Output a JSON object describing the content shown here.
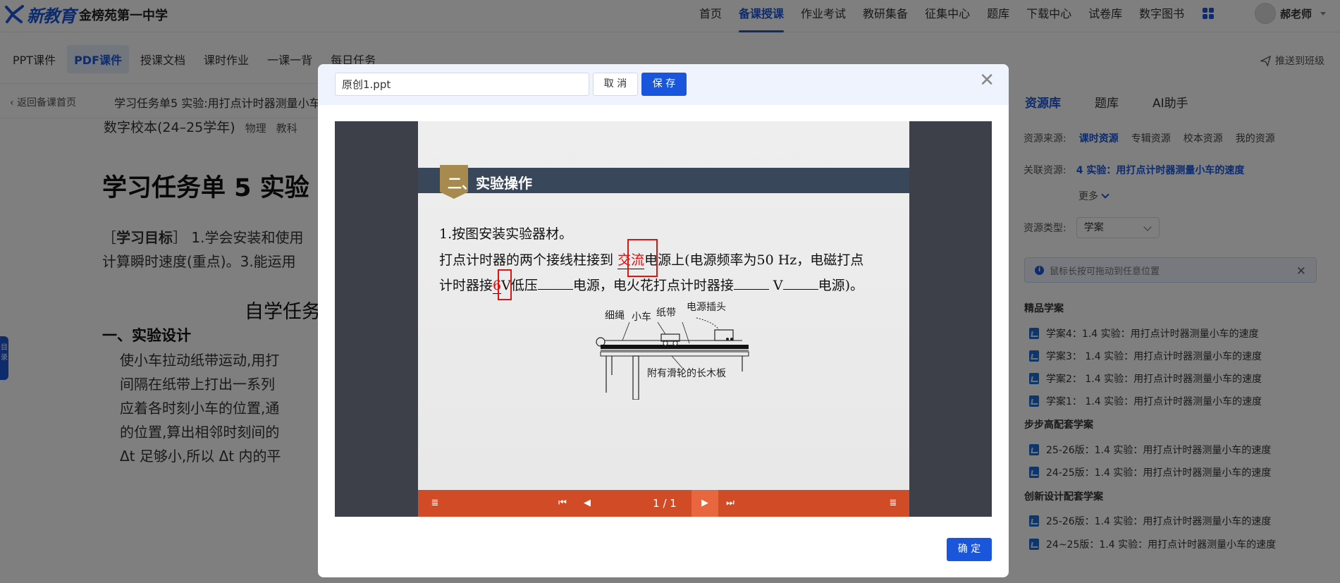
{
  "header": {
    "logo_text": "新教育",
    "school": "金榜苑第一中学",
    "nav": [
      "首页",
      "备课授课",
      "作业考试",
      "教研集备",
      "征集中心",
      "题库",
      "下载中心",
      "试卷库",
      "数字图书"
    ],
    "active_nav": 1,
    "user_name": "郝老师"
  },
  "subtabs": [
    "PPT课件",
    "PDF课件",
    "授课文档",
    "课时作业",
    "一课一背",
    "每日任务"
  ],
  "active_subtab": 1,
  "push_label": "推送到班级",
  "breadcrumb": {
    "back": "返回备课首页",
    "path": "学习任务单5   实验:用打点计时器测量小车"
  },
  "document": {
    "meta": "数字校本(24–25学年)",
    "subject": "物理",
    "edition": "教科",
    "title": "学习任务单 5    实验",
    "goal_label": "学习目标",
    "goal_line1": "1.学会安装和使用",
    "goal_line2": "计算瞬时速度(重点)。3.能运用",
    "subtitle": "自学任务",
    "section": "一、实验设计",
    "body": [
      "使小车拉动纸带运动,用打",
      "间隔在纸带上打出一系列",
      "应着各时刻小车的位置,通",
      "的位置,算出相邻时刻间的",
      "Δt 足够小,所以 Δt 内的平"
    ],
    "side_handle": "目录"
  },
  "right_panel": {
    "tabs": [
      "资源库",
      "题库",
      "AI助手"
    ],
    "active_tab": 0,
    "source_label": "资源来源:",
    "sources": [
      "课时资源",
      "专辑资源",
      "校本资源",
      "我的资源"
    ],
    "active_source": 0,
    "related_label": "关联资源:",
    "related_value": "4   实验：用打点计时器测量小车的速度",
    "more": "更多",
    "type_label": "资源类型:",
    "type_value": "学案",
    "notice": "鼠标长按可拖动到任意位置",
    "groups": [
      {
        "title": "精品学案",
        "items": [
          "学案4：1.4    实验：用打点计时器测量小车的速度",
          "学案3： 1.4 实验：用打点计时器测量小车的速度",
          "学案2： 1.4 实验：用打点计时器测量小车的速度",
          "学案1： 1.4 实验：用打点计时器测量小车的速度"
        ]
      },
      {
        "title": "步步高配套学案",
        "items": [
          "25-26版：1.4    实验：用打点计时器测量小车的速度",
          "24-25版：1.4    实验：用打点计时器测量小车的速度"
        ]
      },
      {
        "title": "创新设计配套学案",
        "items": [
          "25-26版：1.4    实验：用打点计时器测量小车的速度",
          "24~25版：1.4    实验：用打点计时器测量小车的速度"
        ]
      }
    ]
  },
  "modal": {
    "filename": "原创1.ppt",
    "cancel": "取 消",
    "save": "保 存",
    "confirm": "确 定",
    "slide": {
      "section_num": "二、",
      "section_title": "实验操作",
      "line1": "1.按图安装实验器材。",
      "line2_a": "打点计时器的两个接线柱接到",
      "line2_ans": "交流",
      "line2_b": "电源上(电源频率为50 Hz，电磁打点",
      "line3_a": "计时器接",
      "line3_ans": "6",
      "line3_b": "V低压",
      "line3_c": "电源，电火花打点计时器接",
      "line3_d": "V",
      "line3_e": "电源)。",
      "labels": [
        "细绳",
        "小车",
        "纸带",
        "电源插头",
        "附有滑轮的长木板"
      ]
    },
    "pager": "1 / 1"
  }
}
